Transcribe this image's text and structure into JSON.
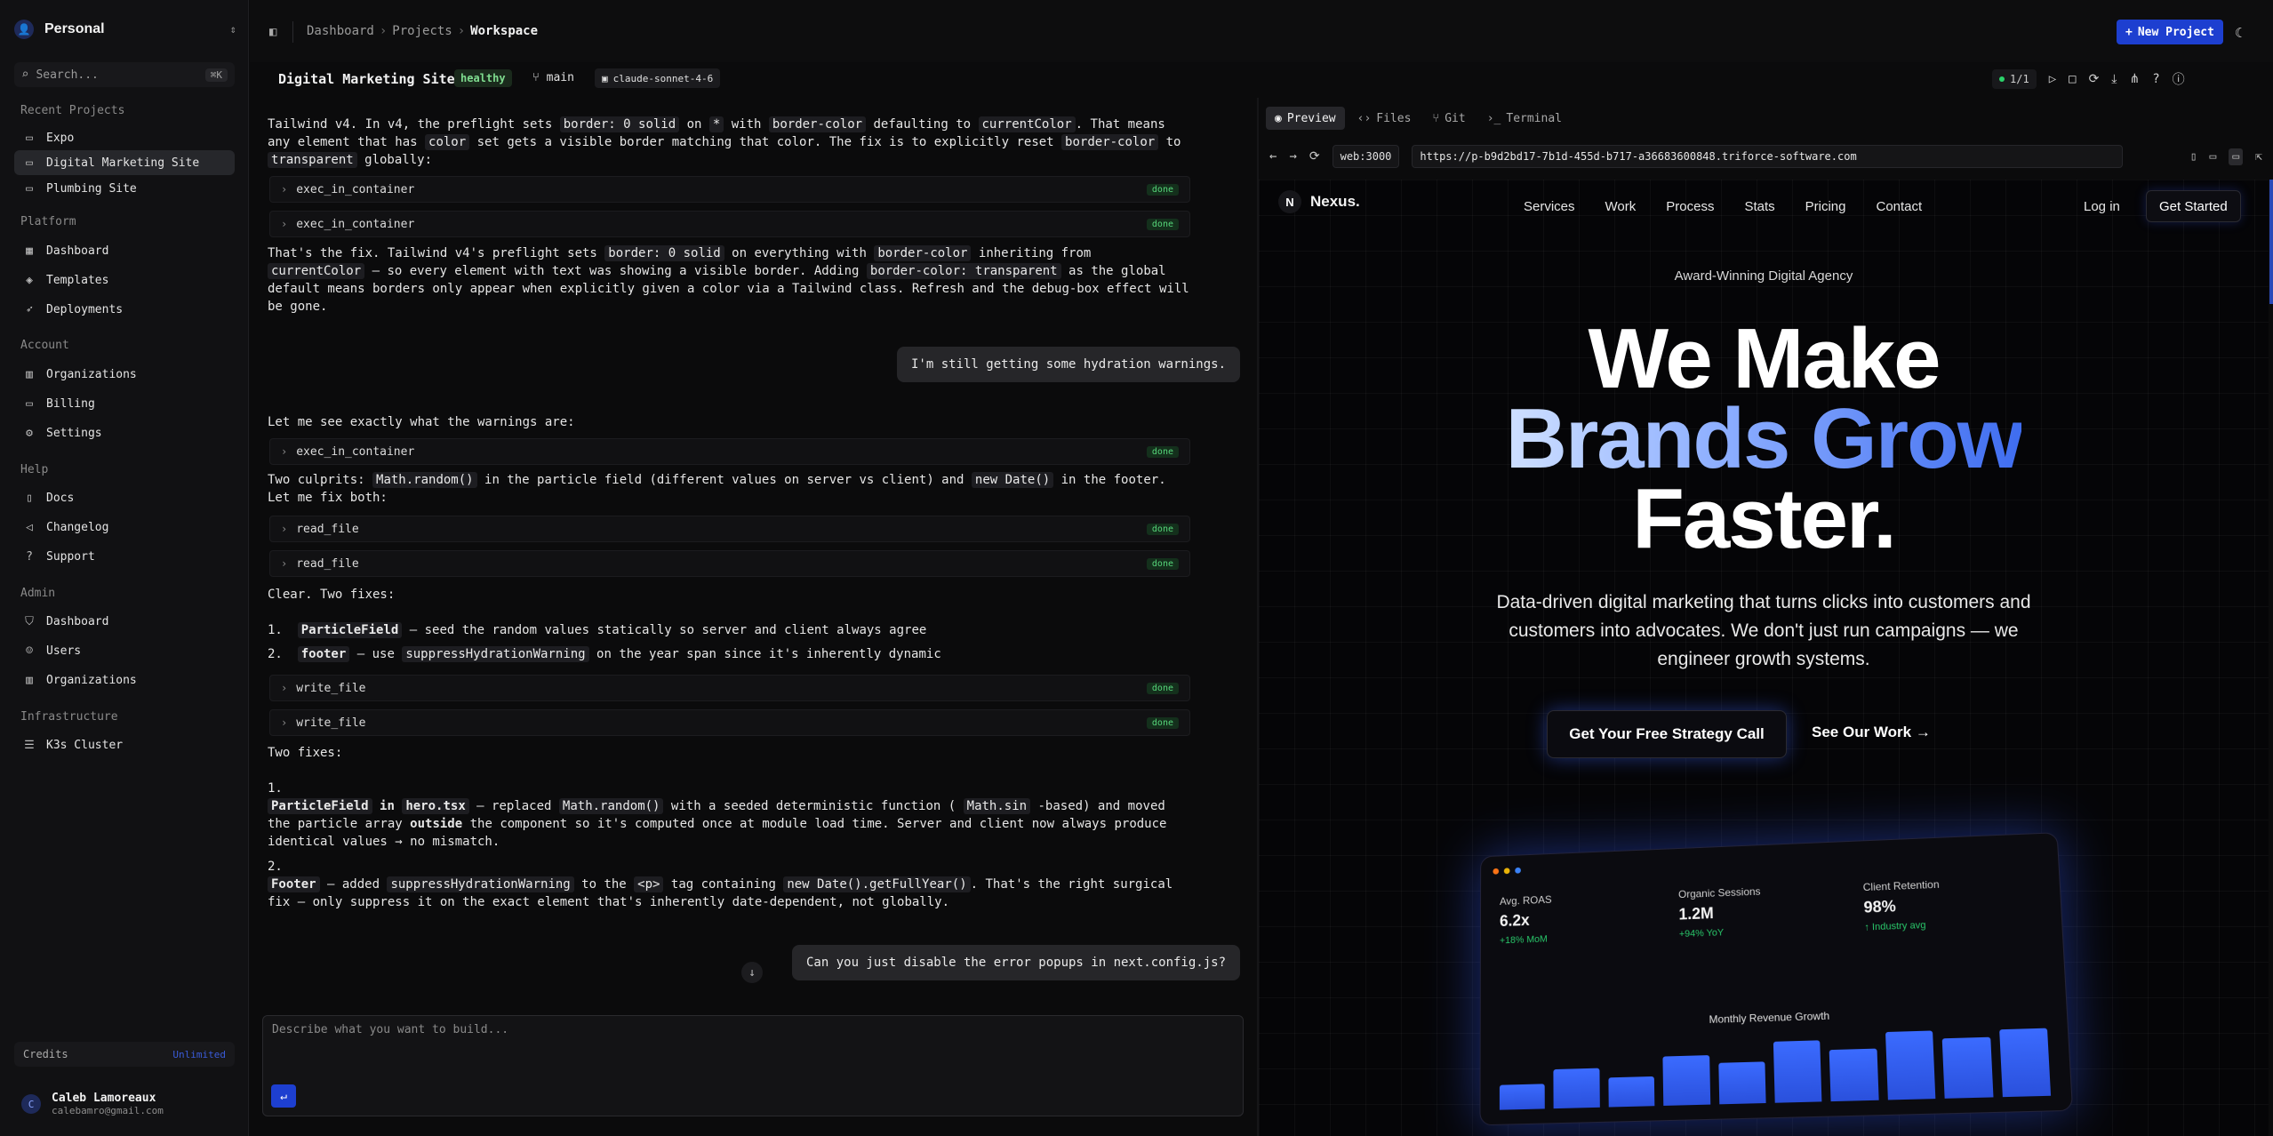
{
  "sidebar": {
    "workspace": "Personal",
    "search_placeholder": "Search...",
    "search_shortcut": "⌘K",
    "sections": [
      {
        "title": "Recent Projects",
        "items": [
          {
            "label": "Expo",
            "icon": "folder-icon"
          },
          {
            "label": "Digital Marketing Site",
            "icon": "folder-icon",
            "active": true
          },
          {
            "label": "Plumbing Site",
            "icon": "folder-icon"
          }
        ]
      },
      {
        "title": "Platform",
        "items": [
          {
            "label": "Dashboard",
            "icon": "dashboard-icon"
          },
          {
            "label": "Templates",
            "icon": "layers-icon"
          },
          {
            "label": "Deployments",
            "icon": "rocket-icon"
          }
        ]
      },
      {
        "title": "Account",
        "items": [
          {
            "label": "Organizations",
            "icon": "building-icon"
          },
          {
            "label": "Billing",
            "icon": "card-icon"
          },
          {
            "label": "Settings",
            "icon": "gear-icon"
          }
        ]
      },
      {
        "title": "Help",
        "items": [
          {
            "label": "Docs",
            "icon": "book-icon"
          },
          {
            "label": "Changelog",
            "icon": "megaphone-icon"
          },
          {
            "label": "Support",
            "icon": "help-icon"
          }
        ]
      },
      {
        "title": "Admin",
        "items": [
          {
            "label": "Dashboard",
            "icon": "shield-icon"
          },
          {
            "label": "Users",
            "icon": "users-icon"
          },
          {
            "label": "Organizations",
            "icon": "building-icon"
          }
        ]
      },
      {
        "title": "Infrastructure",
        "items": [
          {
            "label": "K3s Cluster",
            "icon": "server-icon"
          }
        ]
      }
    ],
    "credits": {
      "label": "Credits",
      "value": "Unlimited"
    },
    "user": {
      "initial": "C",
      "name": "Caleb Lamoreaux",
      "email": "calebamro@gmail.com"
    }
  },
  "topbar": {
    "breadcrumbs": [
      "Dashboard",
      "Projects",
      "Workspace"
    ],
    "new_project": "New Project"
  },
  "project": {
    "title": "Digital Marketing Site",
    "health": "healthy",
    "branch": "main",
    "model": "claude-sonnet-4-6",
    "counter": "1/1"
  },
  "chat": {
    "tool_status": "done",
    "tools": {
      "t1": "exec_in_container",
      "t2": "exec_in_container",
      "t3": "exec_in_container",
      "t4": "read_file",
      "t5": "read_file",
      "t6": "write_file",
      "t7": "write_file"
    },
    "user_msg_1": "I'm still getting some hydration warnings.",
    "user_msg_2": "Can you just disable the error popups in next.config.js?",
    "composer_placeholder": "Describe what you want to build..."
  },
  "preview": {
    "tabs": [
      "Preview",
      "Files",
      "Git",
      "Terminal"
    ],
    "port": "web:3000",
    "url": "https://p-b9d2bd17-7b1d-455d-b717-a36683600848.triforce-software.com"
  },
  "site": {
    "logo_mark": "N",
    "logo_text": "Nexus.",
    "nav": [
      "Services",
      "Work",
      "Process",
      "Stats",
      "Pricing",
      "Contact"
    ],
    "login": "Log in",
    "get_started": "Get Started",
    "eyebrow": "Award-Winning Digital Agency",
    "hero_1": "We Make",
    "hero_2": "Brands Grow",
    "hero_3": "Faster.",
    "subtitle": "Data-driven digital marketing that turns clicks into customers and customers into advocates. We don't just run campaigns — we engineer growth systems.",
    "cta_primary": "Get Your Free Strategy Call",
    "cta_secondary": "See Our Work →",
    "dashboard": {
      "stats": [
        {
          "label": "Avg. ROAS",
          "value": "6.2x",
          "change": "+18% MoM"
        },
        {
          "label": "Organic Sessions",
          "value": "1.2M",
          "change": "+94% YoY"
        },
        {
          "label": "Client Retention",
          "value": "98%",
          "change": "↑ Industry avg"
        }
      ],
      "chart_title": "Monthly Revenue Growth",
      "bar_levels": [
        0.3,
        0.48,
        0.36,
        0.6,
        0.5,
        0.74,
        0.62,
        0.82,
        0.72,
        0.8
      ]
    }
  }
}
